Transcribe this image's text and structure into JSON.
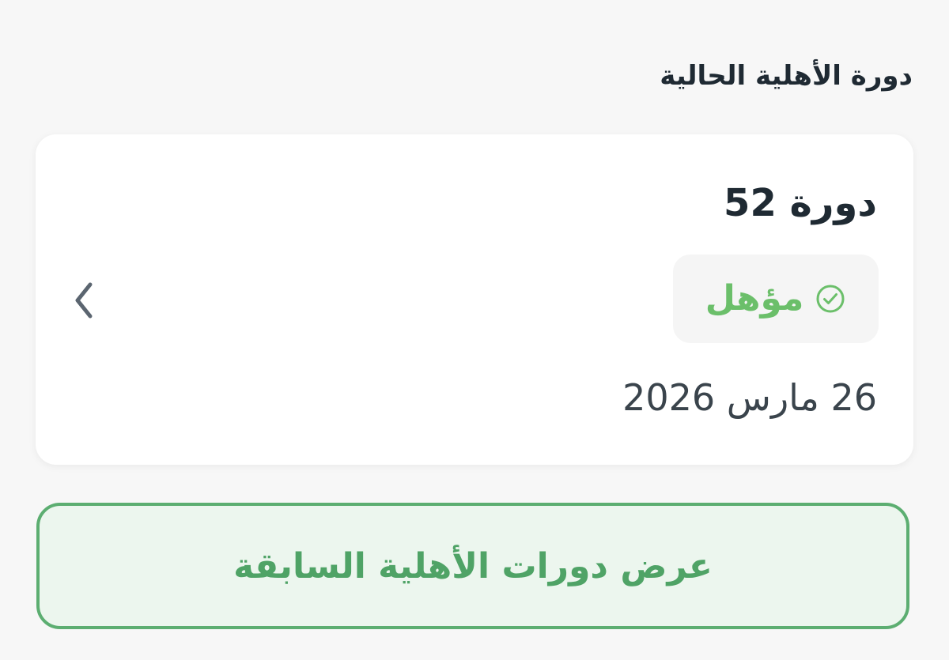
{
  "section": {
    "title": "دورة الأهلية الحالية"
  },
  "current_cycle": {
    "name": "دورة 52",
    "status": {
      "label": "مؤهل",
      "icon": "check-circle-icon",
      "color": "#6bbf6a"
    },
    "date": "26 مارس 2026",
    "nav_icon": "chevron-left-icon"
  },
  "history_button": {
    "label": "عرض دورات الأهلية السابقة",
    "accent_color": "#5cae71",
    "background_color": "#ecf6ee"
  }
}
